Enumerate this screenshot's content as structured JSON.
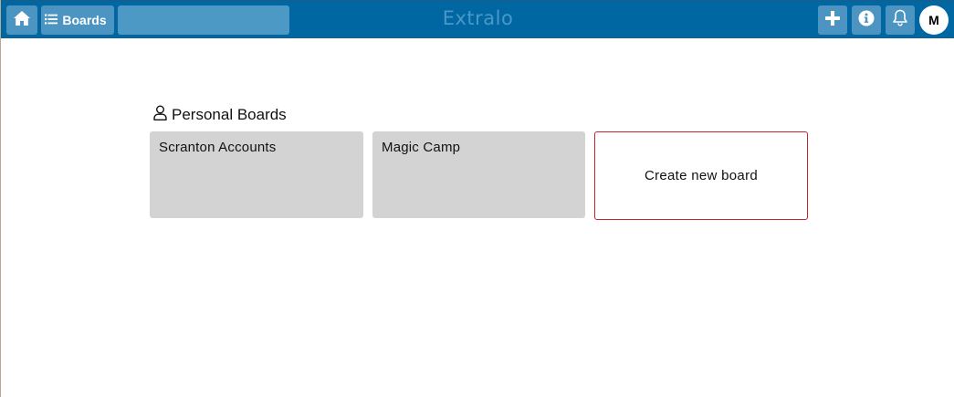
{
  "header": {
    "boards_label": "Boards",
    "search_value": "",
    "app_title": "Extralo",
    "avatar_initial": "M",
    "bar_color": "#0067a3",
    "icons": {
      "home": "home-icon",
      "boards": "list-icon",
      "add": "plus-icon",
      "info": "info-icon",
      "notifications": "bell-icon"
    }
  },
  "main": {
    "section_title": "Personal Boards",
    "section_icon": "user-icon",
    "boards": [
      {
        "title": "Scranton Accounts"
      },
      {
        "title": "Magic Camp"
      }
    ],
    "create_label": "Create new board",
    "create_border_color": "#cc1f2d"
  }
}
